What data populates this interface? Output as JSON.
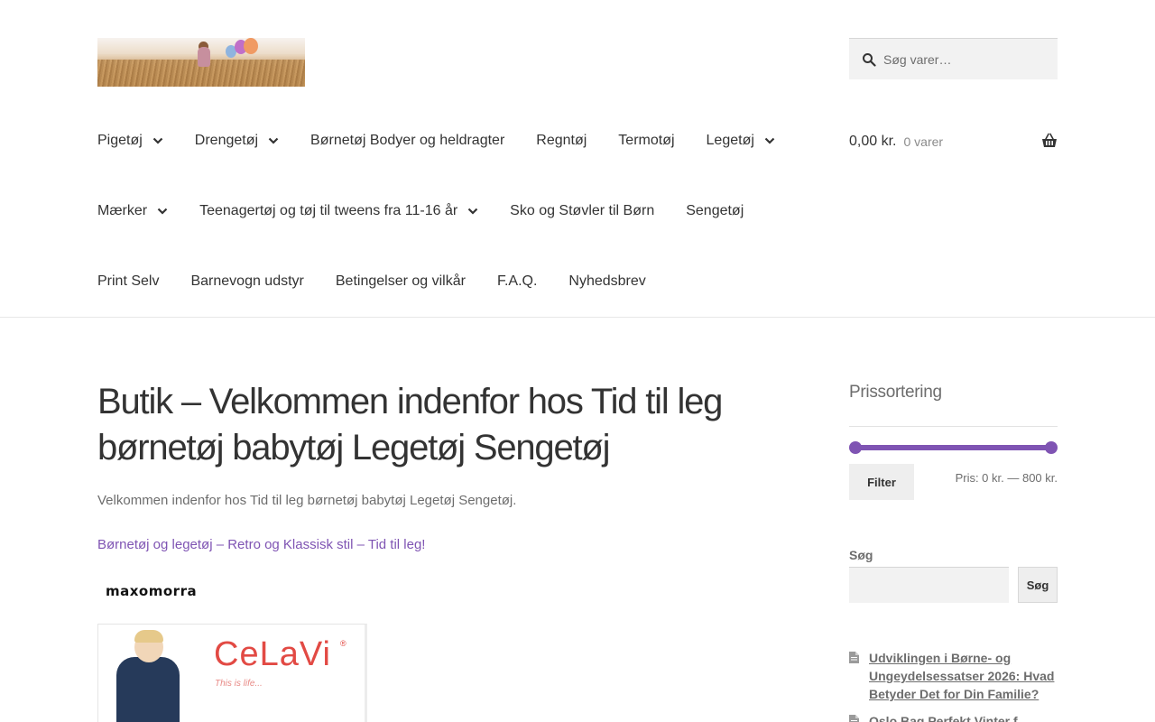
{
  "header": {
    "logo_alt": "Tid til leg",
    "search": {
      "placeholder": "Søg varer…"
    },
    "cart": {
      "amount": "0,00 kr.",
      "count": "0 varer"
    }
  },
  "nav": {
    "rows": [
      [
        {
          "label": "Pigetøj",
          "has_dropdown": true
        },
        {
          "label": "Drengetøj",
          "has_dropdown": true
        },
        {
          "label": "Børnetøj Bodyer og heldragter",
          "has_dropdown": false
        },
        {
          "label": "Regntøj",
          "has_dropdown": false
        },
        {
          "label": "Termotøj",
          "has_dropdown": false
        },
        {
          "label": "Legetøj",
          "has_dropdown": true
        }
      ],
      [
        {
          "label": "Mærker",
          "has_dropdown": true
        },
        {
          "label": "Teenagertøj og tøj til tweens fra 11-16 år",
          "has_dropdown": true
        },
        {
          "label": "Sko og Støvler til Børn",
          "has_dropdown": false
        },
        {
          "label": "Sengetøj",
          "has_dropdown": false
        }
      ],
      [
        {
          "label": "Print Selv",
          "has_dropdown": false
        },
        {
          "label": "Barnevogn udstyr",
          "has_dropdown": false
        },
        {
          "label": "Betingelser og vilkår",
          "has_dropdown": false
        },
        {
          "label": "F.A.Q.",
          "has_dropdown": false
        },
        {
          "label": "Nyhedsbrev",
          "has_dropdown": false
        }
      ]
    ]
  },
  "main": {
    "title": "Butik – Velkommen indenfor hos Tid til leg børnetøj babytøj Legetøj Sengetøj",
    "intro": "Velkommen indenfor hos Tid til leg børnetøj babytøj Legetøj Sengetøj.",
    "link": "Børnetøj og legetøj – Retro og Klassisk stil – Tid til leg!",
    "brand_logo": "maxomorra",
    "banner": {
      "brand": "CeLaVi",
      "tagline": "This is life...",
      "reg_mark": "®"
    }
  },
  "sidebar": {
    "price_filter": {
      "title": "Prissortering",
      "button": "Filter",
      "price_text": "Pris: 0 kr. — 800 kr.",
      "min": 0,
      "max": 800
    },
    "search": {
      "label": "Søg",
      "button": "Søg"
    },
    "posts": [
      "Udviklingen i Børne- og Ungeydelsessatser 2026: Hvad Betyder Det for Din Familie?",
      "Oslo Bag Perfekt Vinter f..."
    ]
  },
  "colors": {
    "accent": "#7f54b3",
    "text": "#333333",
    "muted": "#6d6d6d",
    "button_bg": "#eeeeee"
  }
}
